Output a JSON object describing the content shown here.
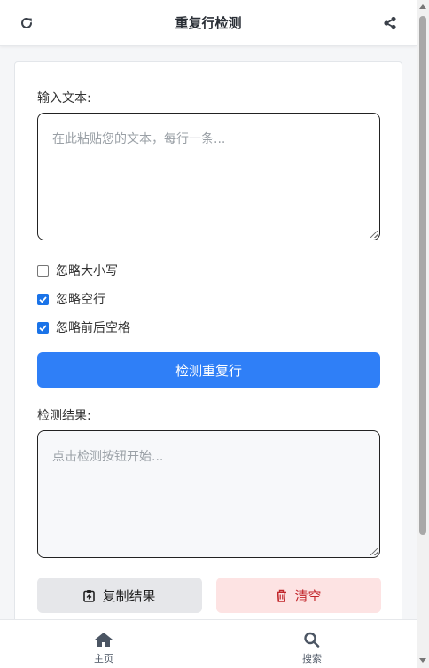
{
  "header": {
    "title": "重复行检测",
    "left_icon": "refresh-icon",
    "right_icon": "share-icon"
  },
  "input": {
    "label": "输入文本:",
    "placeholder": "在此粘贴您的文本，每行一条..."
  },
  "options": [
    {
      "label": "忽略大小写",
      "checked": false
    },
    {
      "label": "忽略空行",
      "checked": true
    },
    {
      "label": "忽略前后空格",
      "checked": true
    }
  ],
  "detect_button": "检测重复行",
  "result": {
    "label": "检测结果:",
    "placeholder": "点击检测按钮开始..."
  },
  "actions": {
    "copy_label": "复制结果",
    "clear_label": "清空"
  },
  "nav": {
    "home": "主页",
    "search": "搜索"
  },
  "colors": {
    "primary": "#2f7ff7",
    "danger_text": "#c2262b",
    "danger_bg": "#fde3e3",
    "neutral_bg": "#e6e7ea"
  }
}
